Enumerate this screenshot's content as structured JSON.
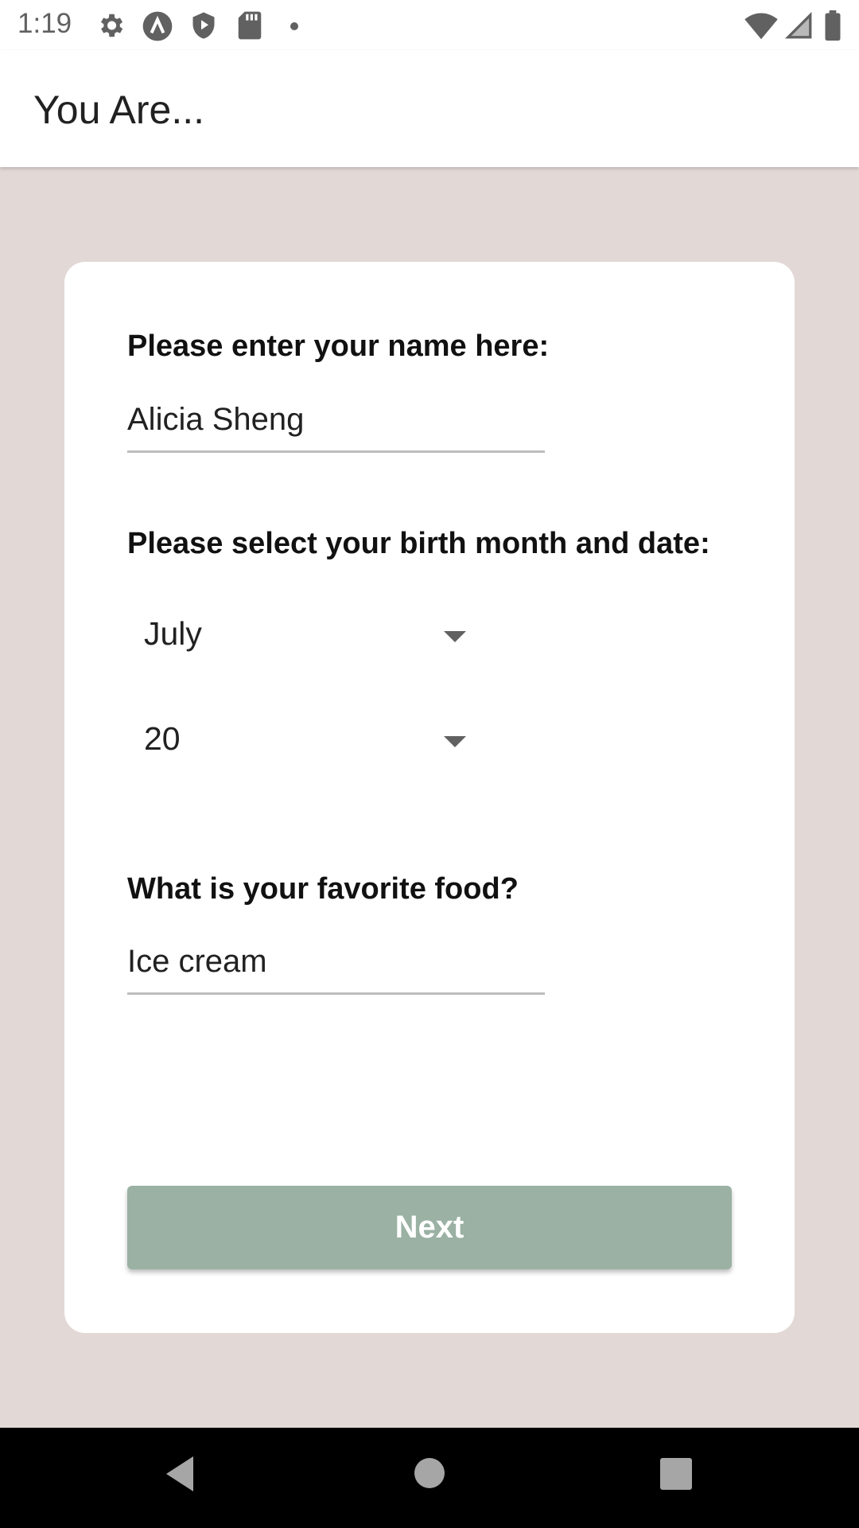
{
  "status_bar": {
    "time": "1:19",
    "left_icons": [
      "settings-icon",
      "app-logo-icon",
      "shield-play-icon",
      "sd-card-icon",
      "dot-icon"
    ],
    "right_icons": [
      "wifi-icon",
      "signal-icon",
      "battery-icon"
    ]
  },
  "app_bar": {
    "title": "You Are..."
  },
  "form": {
    "name_label": "Please enter your name here:",
    "name_value": "Alicia Sheng",
    "birth_label": "Please select your birth month and date:",
    "month_value": "July",
    "day_value": "20",
    "food_label": "What is your favorite food?",
    "food_value": "Ice cream",
    "next_label": "Next"
  },
  "colors": {
    "background": "#e2d8d5",
    "card": "#ffffff",
    "button": "#9ab1a3",
    "nav_bar": "#000000"
  },
  "nav_bar": {
    "buttons": [
      "back-icon",
      "home-icon",
      "recents-icon"
    ]
  }
}
